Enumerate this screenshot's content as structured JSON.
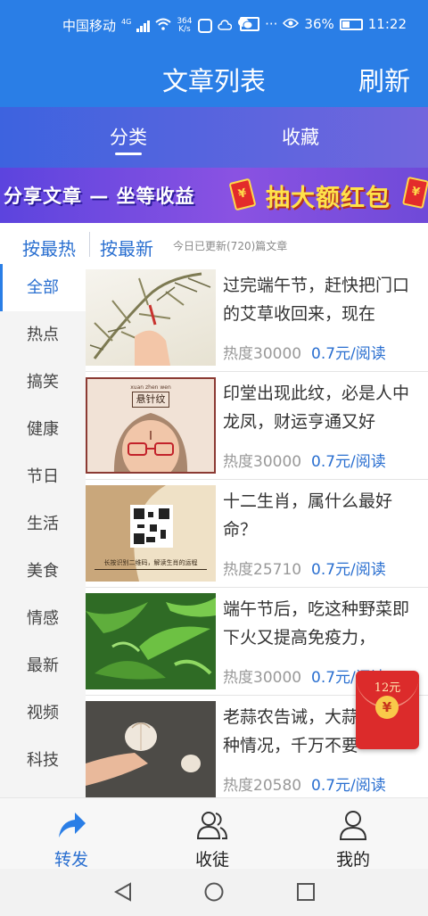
{
  "status_bar": {
    "carrier": "中国移动",
    "network_type": "4G",
    "net_speed_value": "364",
    "net_speed_unit": "K/s",
    "battery": "36%",
    "time": "11:22"
  },
  "header": {
    "title": "文章列表",
    "refresh_label": "刷新"
  },
  "tabs": [
    {
      "label": "分类",
      "active": true
    },
    {
      "label": "收藏",
      "active": false
    }
  ],
  "banner": {
    "left_text": "分享文章 — 坐等收益",
    "right_text": "抽大额红包",
    "envelope_symbol": "¥"
  },
  "sort_bar": {
    "hot_label": "按最热",
    "new_label": "按最新",
    "update_info": "今日已更新(720)篇文章"
  },
  "categories": [
    {
      "label": "全部",
      "active": true
    },
    {
      "label": "热点",
      "active": false
    },
    {
      "label": "搞笑",
      "active": false
    },
    {
      "label": "健康",
      "active": false
    },
    {
      "label": "节日",
      "active": false
    },
    {
      "label": "生活",
      "active": false
    },
    {
      "label": "美食",
      "active": false
    },
    {
      "label": "情感",
      "active": false
    },
    {
      "label": "最新",
      "active": false
    },
    {
      "label": "视频",
      "active": false
    },
    {
      "label": "科技",
      "active": false
    }
  ],
  "articles": [
    {
      "title": "过完端午节，赶快把门口的艾草收回来，现在",
      "heat": "热度30000",
      "price": "0.7元/阅读"
    },
    {
      "title": "印堂出现此纹，必是人中龙凤，财运亨通又好",
      "heat": "热度30000",
      "price": "0.7元/阅读",
      "thumb_text": "悬针纹",
      "thumb_subtext": "xuan zhen wen"
    },
    {
      "title": "十二生肖，属什么最好命？",
      "heat": "热度25710",
      "price": "0.7元/阅读",
      "thumb_text": "长按识别二维码，解读生肖的运程"
    },
    {
      "title": "端午节后，吃这种野菜即下火又提高免疫力，",
      "heat": "热度30000",
      "price": "0.7元/阅读"
    },
    {
      "title": "老蒜农告诫，大蒜出现这3种情况，千万不要",
      "heat": "热度20580",
      "price": "0.7元/阅读"
    }
  ],
  "float_redpack": {
    "amount": "12元",
    "symbol": "¥"
  },
  "bottom_nav": [
    {
      "label": "转发",
      "icon": "share-arrow-icon",
      "active": true
    },
    {
      "label": "收徒",
      "icon": "users-icon",
      "active": false
    },
    {
      "label": "我的",
      "icon": "user-icon",
      "active": false
    }
  ],
  "colors": {
    "primary": "#2a7ee6",
    "link_blue": "#2a6fd0",
    "banner_purple": "#7a4ee0",
    "redpack_red": "#dc2b2b"
  }
}
